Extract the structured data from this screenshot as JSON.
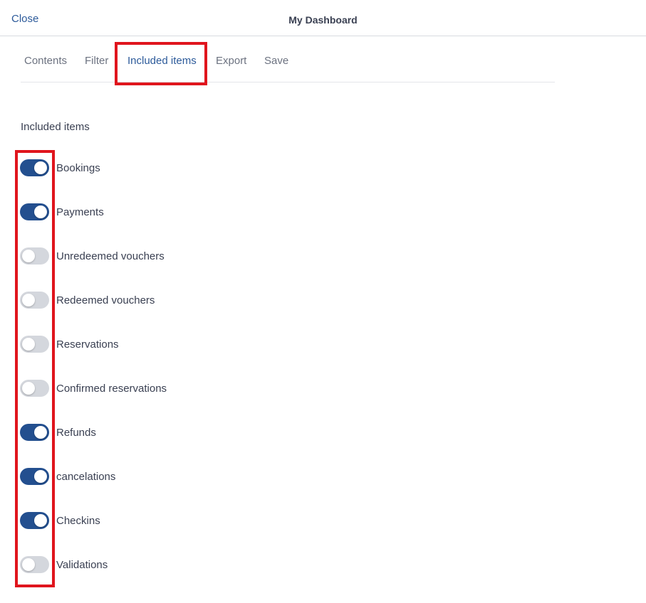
{
  "header": {
    "close_label": "Close",
    "title": "My Dashboard"
  },
  "tabs": [
    {
      "label": "Contents",
      "active": false
    },
    {
      "label": "Filter",
      "active": false
    },
    {
      "label": "Included items",
      "active": true
    },
    {
      "label": "Export",
      "active": false
    },
    {
      "label": "Save",
      "active": false
    }
  ],
  "section": {
    "title": "Included items"
  },
  "items": [
    {
      "label": "Bookings",
      "enabled": true
    },
    {
      "label": "Payments",
      "enabled": true
    },
    {
      "label": "Unredeemed vouchers",
      "enabled": false
    },
    {
      "label": "Redeemed vouchers",
      "enabled": false
    },
    {
      "label": "Reservations",
      "enabled": false
    },
    {
      "label": "Confirmed reservations",
      "enabled": false
    },
    {
      "label": "Refunds",
      "enabled": true
    },
    {
      "label": "cancelations",
      "enabled": true
    },
    {
      "label": "Checkins",
      "enabled": true
    },
    {
      "label": "Validations",
      "enabled": false
    }
  ],
  "colors": {
    "accent": "#234f8f",
    "link": "#2c5a9a",
    "toggle_off": "#d4d7dd",
    "highlight": "#e0151d"
  }
}
